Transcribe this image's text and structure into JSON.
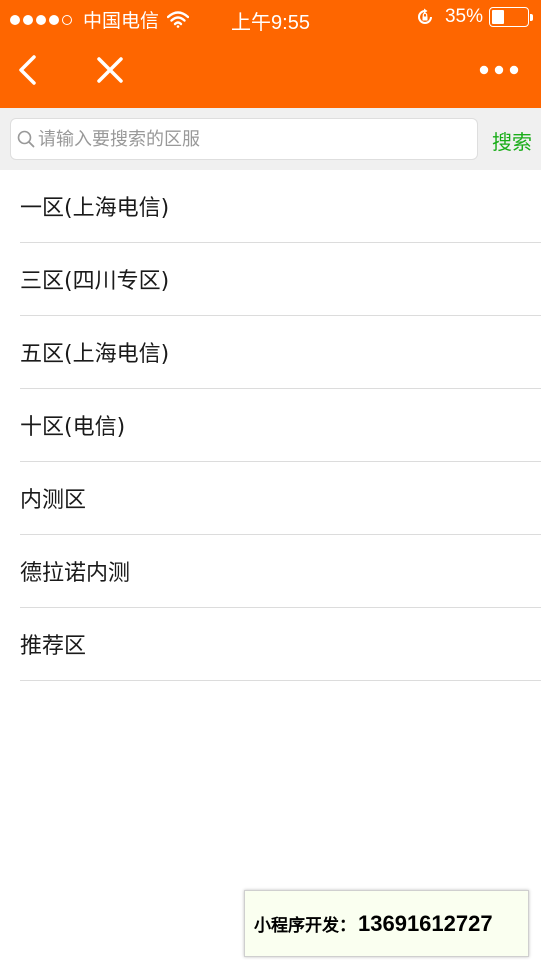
{
  "status_bar": {
    "carrier": "中国电信",
    "time": "上午9:55",
    "battery_text": "35%",
    "battery_level": 0.35
  },
  "nav": {
    "back_icon": "chevron-left-icon",
    "close_icon": "close-icon",
    "more_icon": "more-dots-icon"
  },
  "search": {
    "placeholder": "请输入要搜索的区服",
    "value": "",
    "button_label": "搜索"
  },
  "server_list": [
    "一区(上海电信)",
    "三区(四川专区)",
    "五区(上海电信)",
    "十区(电信)",
    "内测区",
    "德拉诺内测",
    "推荐区"
  ],
  "contact": {
    "label": "小程序开发：",
    "phone": "13691612727"
  },
  "colors": {
    "header": "#fe6600",
    "search_button": "#1aad19"
  }
}
